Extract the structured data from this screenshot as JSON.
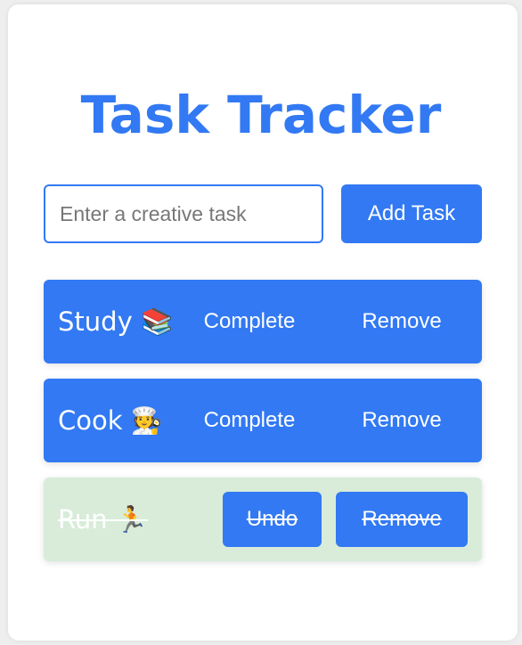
{
  "app": {
    "title": "Task Tracker"
  },
  "form": {
    "placeholder": "Enter a creative task",
    "value": "",
    "add_label": "Add Task"
  },
  "tasks": [
    {
      "name": "Study 📚",
      "completed": false,
      "action_label": "Complete",
      "remove_label": "Remove"
    },
    {
      "name": "Cook 🧑‍🍳",
      "completed": false,
      "action_label": "Complete",
      "remove_label": "Remove"
    },
    {
      "name": "Run 🏃",
      "completed": true,
      "action_label": "Undo",
      "remove_label": "Remove"
    }
  ],
  "colors": {
    "accent": "#3279f3",
    "completed_bg": "#d8ecd9",
    "card_bg": "#ffffff",
    "page_bg": "#eeeeee"
  }
}
